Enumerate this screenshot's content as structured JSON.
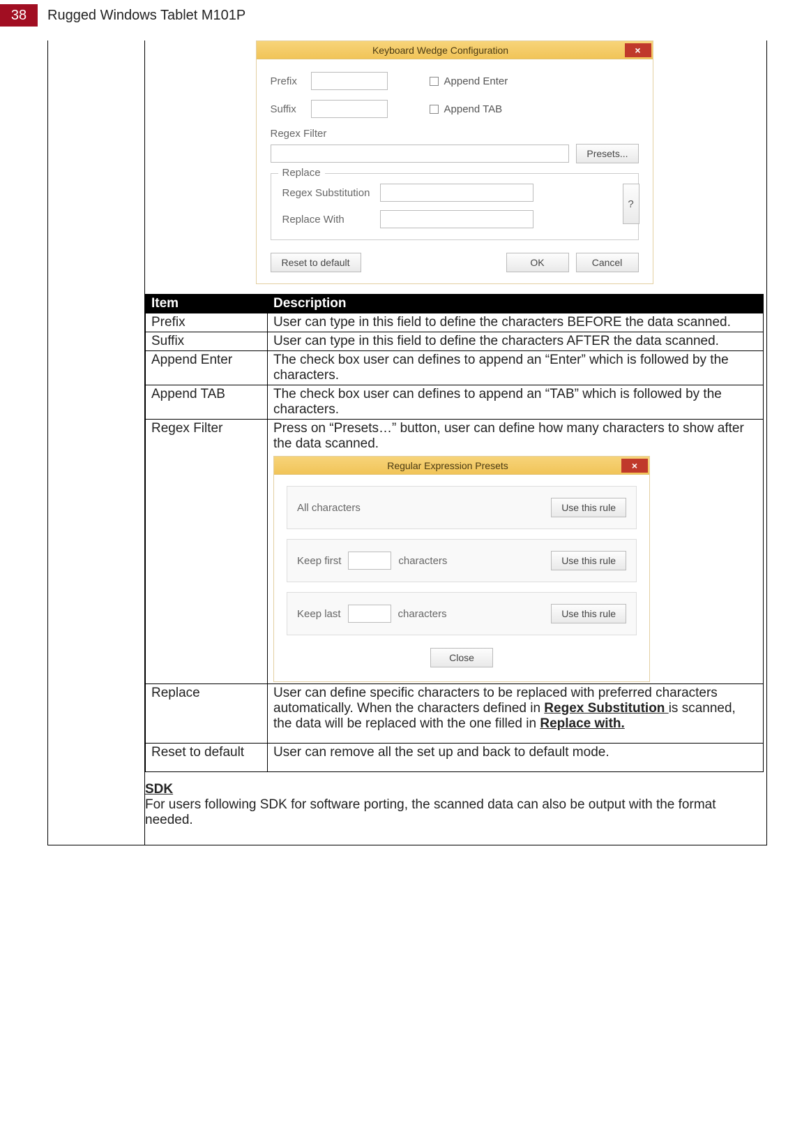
{
  "page": {
    "number": "38",
    "title": "Rugged Windows Tablet M101P"
  },
  "dialog1": {
    "title": "Keyboard Wedge Configuration",
    "close": "×",
    "prefix_label": "Prefix",
    "suffix_label": "Suffix",
    "append_enter": "Append Enter",
    "append_tab": "Append TAB",
    "regex_filter_label": "Regex Filter",
    "presets_btn": "Presets...",
    "replace_legend": "Replace",
    "regex_sub_label": "Regex Substitution",
    "replace_with_label": "Replace With",
    "help_btn": "?",
    "reset_btn": "Reset to default",
    "ok_btn": "OK",
    "cancel_btn": "Cancel"
  },
  "table": {
    "head_item": "Item",
    "head_desc": "Description",
    "rows": [
      {
        "item": "Prefix",
        "desc": "User can type in this field to define the characters BEFORE the data scanned."
      },
      {
        "item": "Suffix",
        "desc": "User can type in this field to define the characters AFTER the data scanned."
      },
      {
        "item": "Append Enter",
        "desc": "The check box user can defines to append an “Enter” which is followed by the characters."
      },
      {
        "item": "Append TAB",
        "desc": "The check box user can defines to append an “TAB” which is followed by the characters."
      },
      {
        "item": "Regex Filter",
        "desc": "Press on “Presets…” button, user can define how many characters to show after the data scanned."
      },
      {
        "item": "Replace",
        "desc_pre": "User can define specific characters to be replaced with preferred characters automatically. When the characters defined in ",
        "bold1": "Regex Substitution ",
        "desc_mid": "is scanned, the data will be replaced with the one filled in ",
        "bold2": "Replace with."
      },
      {
        "item": "Reset to default",
        "desc": "User can remove all the set up and back to default mode."
      }
    ]
  },
  "dialog2": {
    "title": "Regular Expression Presets",
    "close": "×",
    "all_chars": "All characters",
    "keep_first": "Keep first",
    "keep_last": "Keep last",
    "characters": "characters",
    "use_rule": "Use this rule",
    "close_btn": "Close"
  },
  "sdk": {
    "heading": "SDK",
    "body": "For users following SDK for software porting, the scanned data can also be output with the format needed."
  }
}
